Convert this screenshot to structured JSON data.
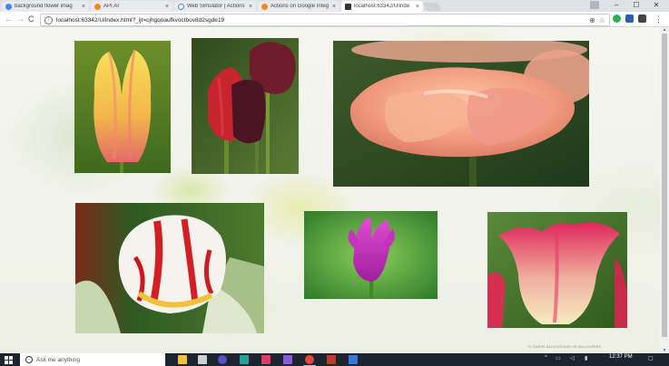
{
  "browser": {
    "tabs": [
      {
        "title": "background flower imag",
        "icon": "google-g-icon",
        "color": "#4285f4"
      },
      {
        "title": "API.AI",
        "icon": "apiai-icon",
        "color": "#f48a28"
      },
      {
        "title": "Web Simulator | Actions",
        "icon": "web-simulator-icon",
        "color": "#4285f4"
      },
      {
        "title": "Actions on Google Integ",
        "icon": "apiai-icon",
        "color": "#f48a28"
      },
      {
        "title": "localhost:63342/U/inde",
        "icon": "jetbrains-icon",
        "color": "#333333",
        "active": true
      }
    ],
    "close_glyph": "×",
    "window_controls": {
      "minimize": "–",
      "maximize": "☐",
      "close": "✕"
    },
    "nav": {
      "back": "←",
      "forward": "→",
      "reload": "C"
    },
    "url": "localhost:63342/U/index.html?_ijt=cjhgqoaufkvoctbov8d2sgde19",
    "omnibox_icons": {
      "zoom": "⊕",
      "star": "☆"
    },
    "extensions": [
      {
        "name": "check-extension-icon",
        "color": "#2eab5b"
      },
      {
        "name": "z-extension-icon",
        "color": "#2b5fae"
      },
      {
        "name": "box-extension-icon",
        "color": "#444444"
      }
    ],
    "menu_glyph": "⋮"
  },
  "page": {
    "photos": [
      {
        "name": "tulip-photo-yellow-pink",
        "subject": "yellow and pink tulip"
      },
      {
        "name": "tulip-photo-red-dark",
        "subject": "red and dark purple tulips"
      },
      {
        "name": "tulip-photo-peach",
        "subject": "peach tulip close-up"
      },
      {
        "name": "tulip-photo-red-white-striped",
        "subject": "red and white striped tulip"
      },
      {
        "name": "tulip-photo-magenta",
        "subject": "magenta tulip"
      },
      {
        "name": "tulip-photo-pink-cream",
        "subject": "pink and cream tulip"
      }
    ],
    "credit": "FLOWERS BACKGROUND HD WALLPAPERS"
  },
  "taskbar": {
    "search_placeholder": "Ask me anything",
    "time": "12:37 PM",
    "apps": [
      {
        "name": "file-explorer-icon",
        "color": "#f0c040"
      },
      {
        "name": "app-icon-2",
        "color": "#d0d0d0"
      },
      {
        "name": "eclipse-icon",
        "color": "#5a4fc4"
      },
      {
        "name": "app-icon-4",
        "color": "#2aa198"
      },
      {
        "name": "intellij-icon",
        "color": "#e03b6b"
      },
      {
        "name": "visual-studio-icon",
        "color": "#8a5bd6"
      },
      {
        "name": "chrome-icon",
        "color": "#e8453c",
        "active": true
      },
      {
        "name": "word-icon",
        "color": "#c0392b"
      },
      {
        "name": "app-icon-9",
        "color": "#3a78d8"
      }
    ]
  }
}
